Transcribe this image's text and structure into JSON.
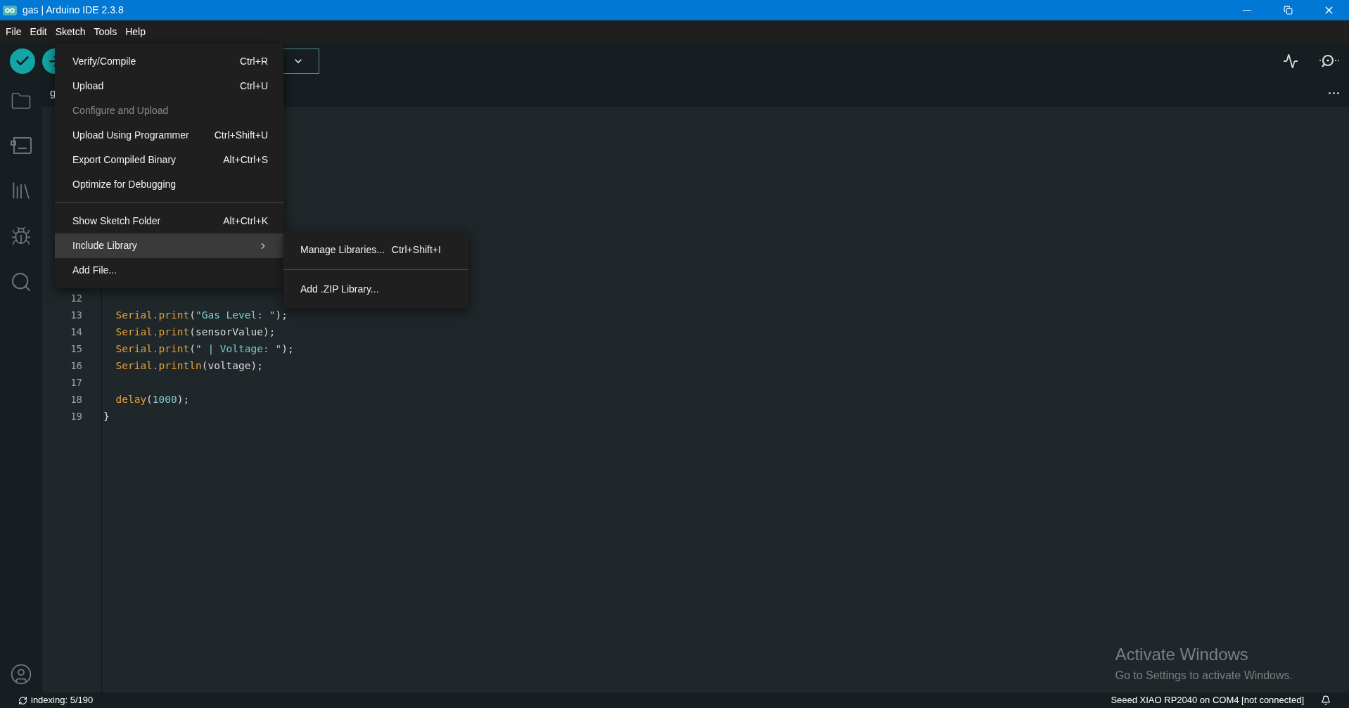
{
  "window": {
    "title": "gas | Arduino IDE 2.3.8"
  },
  "menu_bar": [
    "File",
    "Edit",
    "Sketch",
    "Tools",
    "Help"
  ],
  "tab": {
    "label": "g"
  },
  "sketch_menu": [
    {
      "kind": "item",
      "label": "Verify/Compile",
      "shortcut": "Ctrl+R",
      "disabled": false,
      "selected": false
    },
    {
      "kind": "item",
      "label": "Upload",
      "shortcut": "Ctrl+U",
      "disabled": false,
      "selected": false
    },
    {
      "kind": "item",
      "label": "Configure and Upload",
      "disabled": true,
      "selected": false
    },
    {
      "kind": "item",
      "label": "Upload Using Programmer",
      "shortcut": "Ctrl+Shift+U",
      "disabled": false,
      "selected": false
    },
    {
      "kind": "item",
      "label": "Export Compiled Binary",
      "shortcut": "Alt+Ctrl+S",
      "disabled": false,
      "selected": false
    },
    {
      "kind": "item",
      "label": "Optimize for Debugging",
      "disabled": false,
      "selected": false
    },
    {
      "kind": "separator"
    },
    {
      "kind": "item",
      "label": "Show Sketch Folder",
      "shortcut": "Alt+Ctrl+K",
      "disabled": false,
      "selected": false
    },
    {
      "kind": "submenu",
      "label": "Include Library",
      "disabled": false,
      "selected": true
    },
    {
      "kind": "item",
      "label": "Add File...",
      "disabled": false,
      "selected": false
    }
  ],
  "submenu": [
    {
      "kind": "item",
      "label": "Manage Libraries...",
      "shortcut": "Ctrl+Shift+I"
    },
    {
      "kind": "separator"
    },
    {
      "kind": "item",
      "label": "Add .ZIP Library..."
    }
  ],
  "code": [
    {
      "number": "12"
    },
    {
      "number": "13",
      "tokens": [
        {
          "kind": "fn",
          "text": "  Serial.print"
        },
        {
          "kind": "plain",
          "text": "("
        },
        {
          "kind": "str",
          "text": "\"Gas Level: \""
        },
        {
          "kind": "plain",
          "text": ");"
        }
      ]
    },
    {
      "number": "14",
      "tokens": [
        {
          "kind": "fn",
          "text": "  Serial.print"
        },
        {
          "kind": "plain",
          "text": "(sensorValue);"
        }
      ]
    },
    {
      "number": "15",
      "tokens": [
        {
          "kind": "fn",
          "text": "  Serial.print"
        },
        {
          "kind": "plain",
          "text": "("
        },
        {
          "kind": "str",
          "text": "\" | Voltage: \""
        },
        {
          "kind": "plain",
          "text": ");"
        }
      ]
    },
    {
      "number": "16",
      "tokens": [
        {
          "kind": "fn",
          "text": "  Serial.println"
        },
        {
          "kind": "plain",
          "text": "(voltage);"
        }
      ]
    },
    {
      "number": "17"
    },
    {
      "number": "18",
      "tokens": [
        {
          "kind": "fn",
          "text": "  delay"
        },
        {
          "kind": "plain",
          "text": "("
        },
        {
          "kind": "num",
          "text": "1000"
        },
        {
          "kind": "plain",
          "text": ");"
        }
      ]
    },
    {
      "number": "19",
      "tokens": [
        {
          "kind": "plain",
          "text": "}"
        }
      ]
    }
  ],
  "activation_notice": {
    "title": "Activate Windows",
    "message": "Go to Settings to activate Windows."
  },
  "status_bar": {
    "left": "indexing: 5/190",
    "right": "Seeed XIAO RP2040 on COM4 [not connected]"
  }
}
